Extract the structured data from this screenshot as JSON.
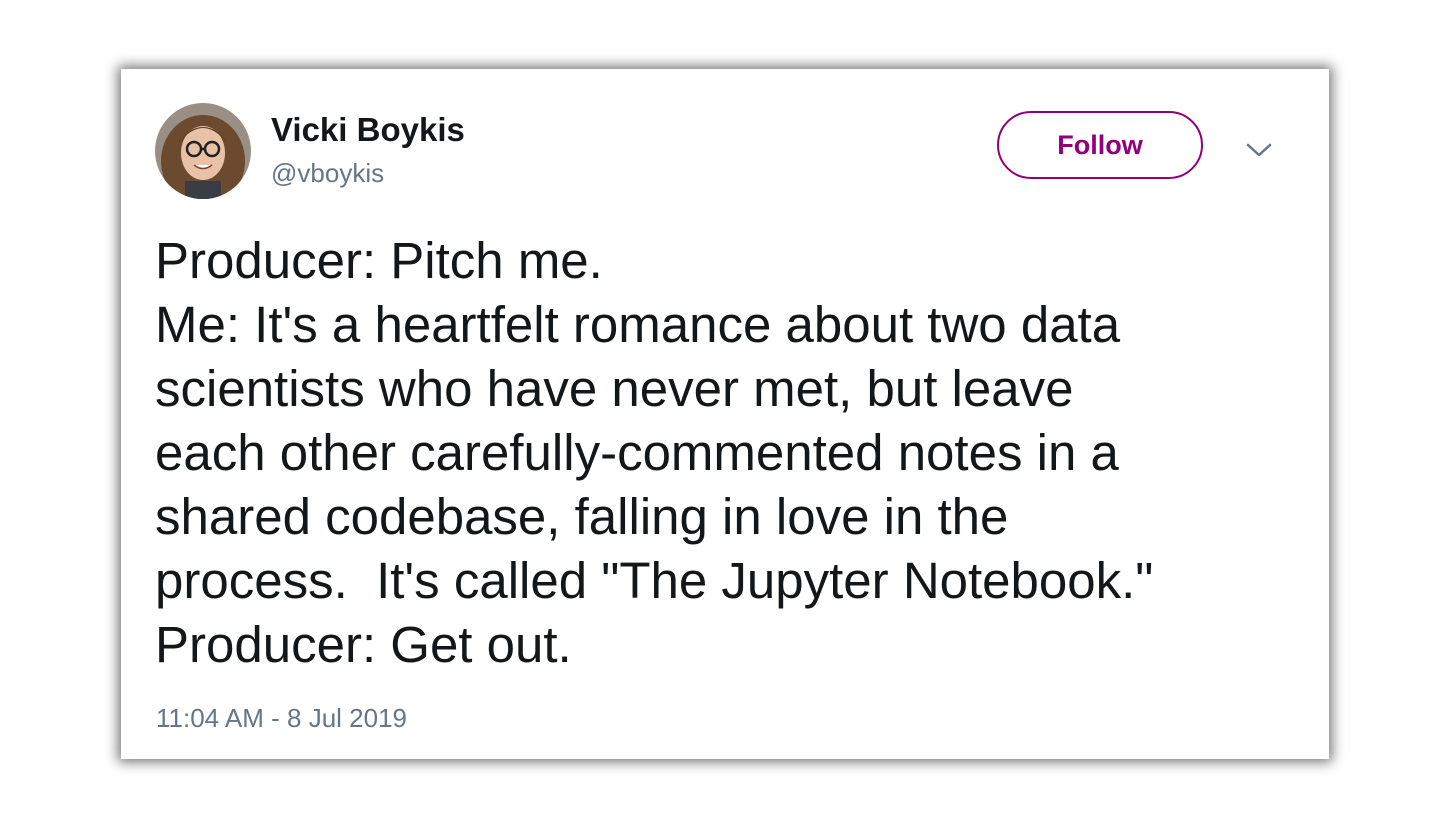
{
  "author": {
    "name": "Vicki Boykis",
    "handle": "@vboykis"
  },
  "actions": {
    "follow_label": "Follow"
  },
  "tweet": {
    "lines": [
      "Producer: Pitch me.",
      "Me: It's a heartfelt romance about two data",
      "scientists who have never met, but leave",
      "each other carefully-commented notes in a",
      "shared codebase, falling in love in the",
      "process.  It's called \"The Jupyter Notebook.\"",
      "Producer: Get out."
    ],
    "timestamp": "11:04 AM - 8 Jul 2019"
  },
  "icons": {
    "menu": "chevron-down-icon",
    "avatar": "avatar-photo"
  },
  "colors": {
    "accent": "#91007b",
    "text": "#14171a",
    "muted": "#657786"
  }
}
